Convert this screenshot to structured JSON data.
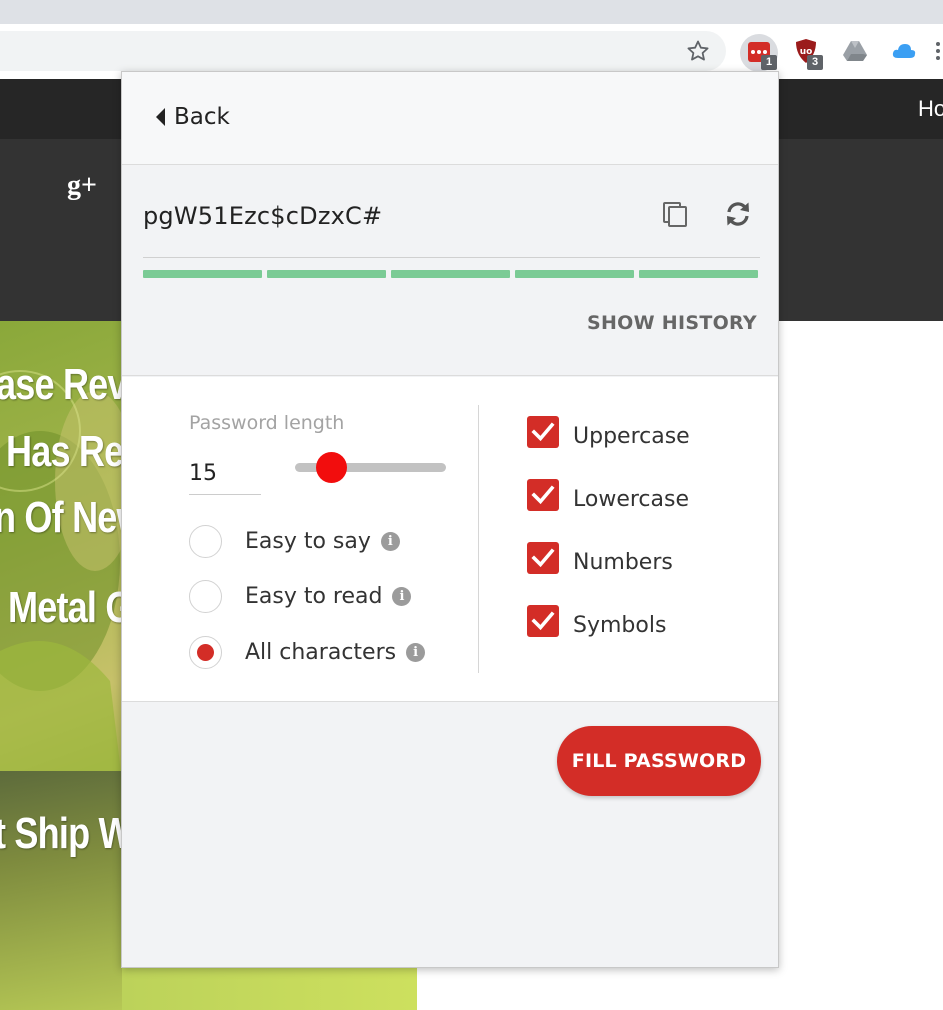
{
  "browser": {
    "extensions": [
      {
        "name": "lastpass-extension-icon",
        "badge": "1"
      },
      {
        "name": "ublock-extension-icon",
        "badge": "3"
      },
      {
        "name": "google-drive-extension-icon"
      },
      {
        "name": "icloud-extension-icon"
      }
    ]
  },
  "website": {
    "nav_link": "Ho",
    "headlines": [
      "ase Rev",
      "Has Re",
      "n Of New",
      "Metal G",
      "t Ship W"
    ]
  },
  "popup": {
    "back_label": "Back",
    "generated_password": "pgW51Ezc$cDzxC#",
    "strength": {
      "segments": 5,
      "filled": 5,
      "color": "#7bcb95"
    },
    "history_label": "SHOW HISTORY",
    "length": {
      "label": "Password length",
      "value": "15",
      "min": 4,
      "max": 50
    },
    "modes": [
      {
        "label": "Easy to say",
        "selected": false,
        "info_icon": "info-icon"
      },
      {
        "label": "Easy to read",
        "selected": false,
        "info_icon": "info-icon"
      },
      {
        "label": "All characters",
        "selected": true,
        "info_icon": "info-icon"
      }
    ],
    "character_sets": [
      {
        "label": "Uppercase",
        "checked": true
      },
      {
        "label": "Lowercase",
        "checked": true
      },
      {
        "label": "Numbers",
        "checked": true
      },
      {
        "label": "Symbols",
        "checked": true
      }
    ],
    "fill_button_label": "FILL PASSWORD",
    "accent_color": "#d32d27",
    "slider_thumb_color": "#f20d0d"
  }
}
